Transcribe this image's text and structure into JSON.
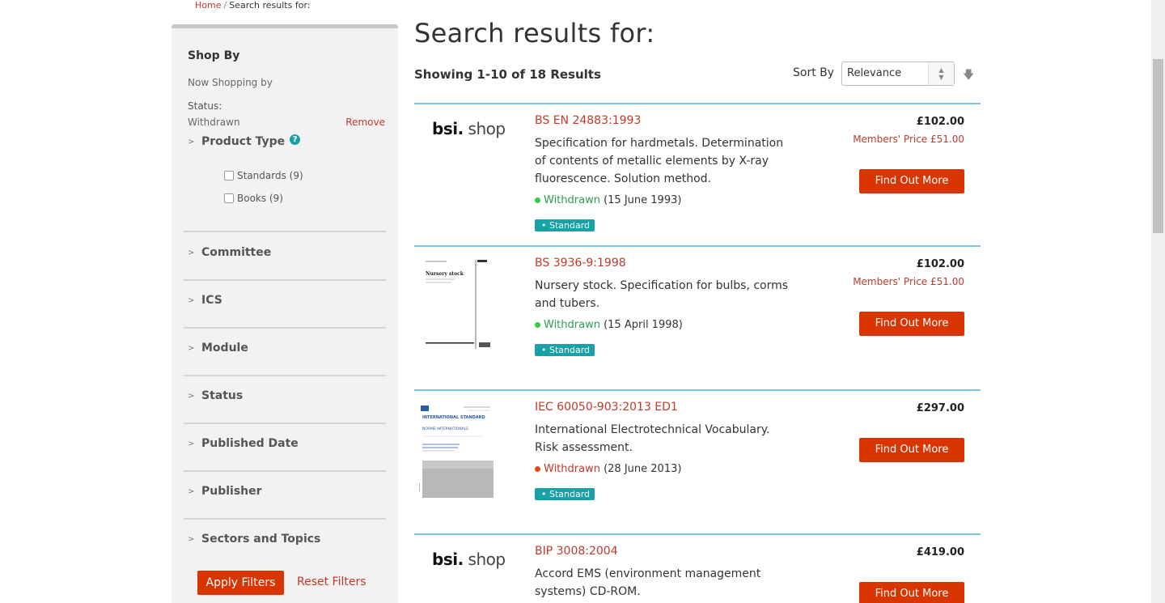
{
  "breadcrumb": {
    "home": "Home",
    "sep": "/",
    "current": "Search results for:"
  },
  "sidebar": {
    "shop_by": "Shop By",
    "now_shopping": "Now Shopping by",
    "status_label": "Status:",
    "status_value": "Withdrawn",
    "remove": "Remove",
    "product_type": {
      "label": "Product Type",
      "help": "?",
      "options": [
        {
          "label": "Standards (9)",
          "checked": false
        },
        {
          "label": "Books (9)",
          "checked": false
        }
      ]
    },
    "facets": [
      "Committee",
      "ICS",
      "Module",
      "Status",
      "Published Date",
      "Publisher",
      "Sectors and Topics"
    ],
    "apply": "Apply Filters",
    "reset": "Reset Filters"
  },
  "main": {
    "title": "Search results for:",
    "showing": "Showing 1-10 of 18 Results",
    "sort_label": "Sort By",
    "sort_value": "Relevance",
    "results": [
      {
        "code": "BS EN 24883:1993",
        "desc": "Specification for hardmetals. Determination of contents of metallic elements by X-ray fluorescence. Solution method.",
        "status": "Withdrawn",
        "date": "(15 June 1993)",
        "tag": "Standard",
        "price": "£102.00",
        "member_price": "Members' Price £51.00",
        "button": "Find Out More",
        "logo": "bsi.",
        "logo_text": "shop"
      },
      {
        "code": "BS 3936-9:1998",
        "desc": "Nursery stock. Specification for bulbs, corms and tubers.",
        "status": "Withdrawn",
        "date": "(15 April 1998)",
        "tag": "Standard",
        "price": "£102.00",
        "member_price": "Members' Price £51.00",
        "button": "Find Out More",
        "thumb_title": "Nursery stock"
      },
      {
        "code": "IEC 60050-903:2013 ED1",
        "desc": "International Electrotechnical Vocabulary. Risk assessment.",
        "status": "Withdrawn",
        "date": "(28 June 2013)",
        "tag": "Standard",
        "price": "£297.00",
        "button": "Find Out More",
        "thumb_title": "INTERNATIONAL STANDARD",
        "thumb_sub": "NORME INTERNATIONALE"
      },
      {
        "code": "BIP 3008:2004",
        "desc": "Accord EMS (environment management systems) CD-ROM.",
        "price": "£419.00",
        "button": "Find Out More",
        "logo": "bsi.",
        "logo_text": "shop"
      }
    ]
  },
  "colors": {
    "accent": "#d93500",
    "link": "#c0392b",
    "divider": "#7cc4e0",
    "tag": "#17a2a8",
    "status_green": "#2e9e4f"
  },
  "icons": {
    "chevron": "chevron-right-icon",
    "help": "help-icon",
    "sort_dir": "arrow-down-icon"
  }
}
